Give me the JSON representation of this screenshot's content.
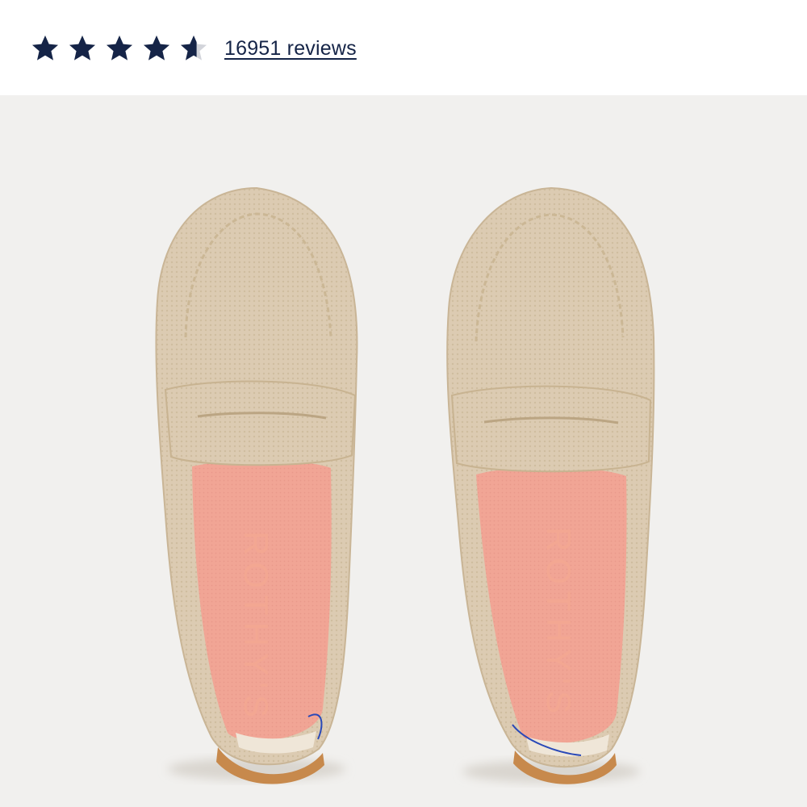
{
  "rating": {
    "value": 4.6,
    "max": 5,
    "reviews_label": "16951 reviews",
    "star_color": "#152447",
    "empty_star_color": "#d2d4da"
  },
  "product_image": {
    "background": "#f1f0ee",
    "upper_color": "#dccbb2",
    "lining_color": "#f1a595",
    "brand_mark": "ROTHY'S"
  }
}
